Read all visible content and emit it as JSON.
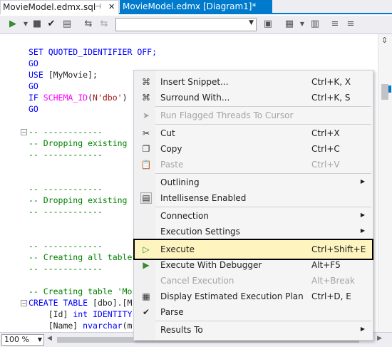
{
  "tabs": {
    "active": {
      "label": "MovieModel.edmx.sql",
      "pin": "⊣",
      "close": "✕"
    },
    "inactive": {
      "label": "MovieModel.edmx [Diagram1]*"
    }
  },
  "toolbar": {
    "query_combo_value": ""
  },
  "code": {
    "l1a": "SET QUOTED_IDENTIFIER OFF;",
    "l2": "GO",
    "l3a": "USE ",
    "l3b": "[MyMovie];",
    "l4": "GO",
    "l5a": "IF ",
    "l5b": "SCHEMA_ID",
    "l5c": "(",
    "l5d": "N'dbo'",
    "l5e": ")",
    "l6": "GO",
    "l7": "-- ------------",
    "l8": "-- Dropping existing",
    "l9": "-- ------------",
    "l10": "-- ------------",
    "l11": "-- Dropping existing",
    "l12": "-- ------------",
    "l13": "-- ------------",
    "l14": "-- Creating all table",
    "l15": "-- ------------",
    "l16": "-- Creating table 'Mo",
    "l17a": "CREATE TABLE",
    "l17b": " [dbo].[M",
    "l18a": "    [Id] ",
    "l18b": "int IDENTITY",
    "l19a": "    [Name] ",
    "l19b": "nvarchar",
    "l19c": "(m"
  },
  "status": {
    "zoom": "100 %"
  },
  "menu": {
    "items": [
      {
        "label": "Insert Snippet...",
        "shortcut": "Ctrl+K, X",
        "icon": "insert-snippet-icon",
        "glyph": "⌘"
      },
      {
        "label": "Surround With...",
        "shortcut": "Ctrl+K, S",
        "icon": "surround-with-icon",
        "glyph": "⌘"
      },
      {
        "label": "Run Flagged Threads To Cursor",
        "shortcut": "",
        "icon": "run-to-cursor-icon",
        "glyph": "➤"
      },
      {
        "label": "Cut",
        "shortcut": "Ctrl+X",
        "icon": "cut-icon",
        "glyph": "✂"
      },
      {
        "label": "Copy",
        "shortcut": "Ctrl+C",
        "icon": "copy-icon",
        "glyph": "❐"
      },
      {
        "label": "Paste",
        "shortcut": "Ctrl+V",
        "icon": "paste-icon",
        "glyph": "📋"
      },
      {
        "label": "Outlining",
        "shortcut": "",
        "icon": "",
        "glyph": ""
      },
      {
        "label": "Intellisense Enabled",
        "shortcut": "",
        "icon": "intellisense-icon",
        "glyph": "▤"
      },
      {
        "label": "Connection",
        "shortcut": "",
        "icon": "",
        "glyph": ""
      },
      {
        "label": "Execution Settings",
        "shortcut": "",
        "icon": "",
        "glyph": ""
      },
      {
        "label": "Execute",
        "shortcut": "Ctrl+Shift+E",
        "icon": "execute-icon",
        "glyph": "▷"
      },
      {
        "label": "Execute With Debugger",
        "shortcut": "Alt+F5",
        "icon": "execute-debugger-icon",
        "glyph": "▶"
      },
      {
        "label": "Cancel Execution",
        "shortcut": "Alt+Break",
        "icon": "",
        "glyph": ""
      },
      {
        "label": "Display Estimated Execution Plan",
        "shortcut": "Ctrl+D, E",
        "icon": "execution-plan-icon",
        "glyph": "▦"
      },
      {
        "label": "Parse",
        "shortcut": "",
        "icon": "check-icon",
        "glyph": "✔"
      },
      {
        "label": "Results To",
        "shortcut": "",
        "icon": "",
        "glyph": ""
      }
    ],
    "submenu_arrow": "▶"
  }
}
